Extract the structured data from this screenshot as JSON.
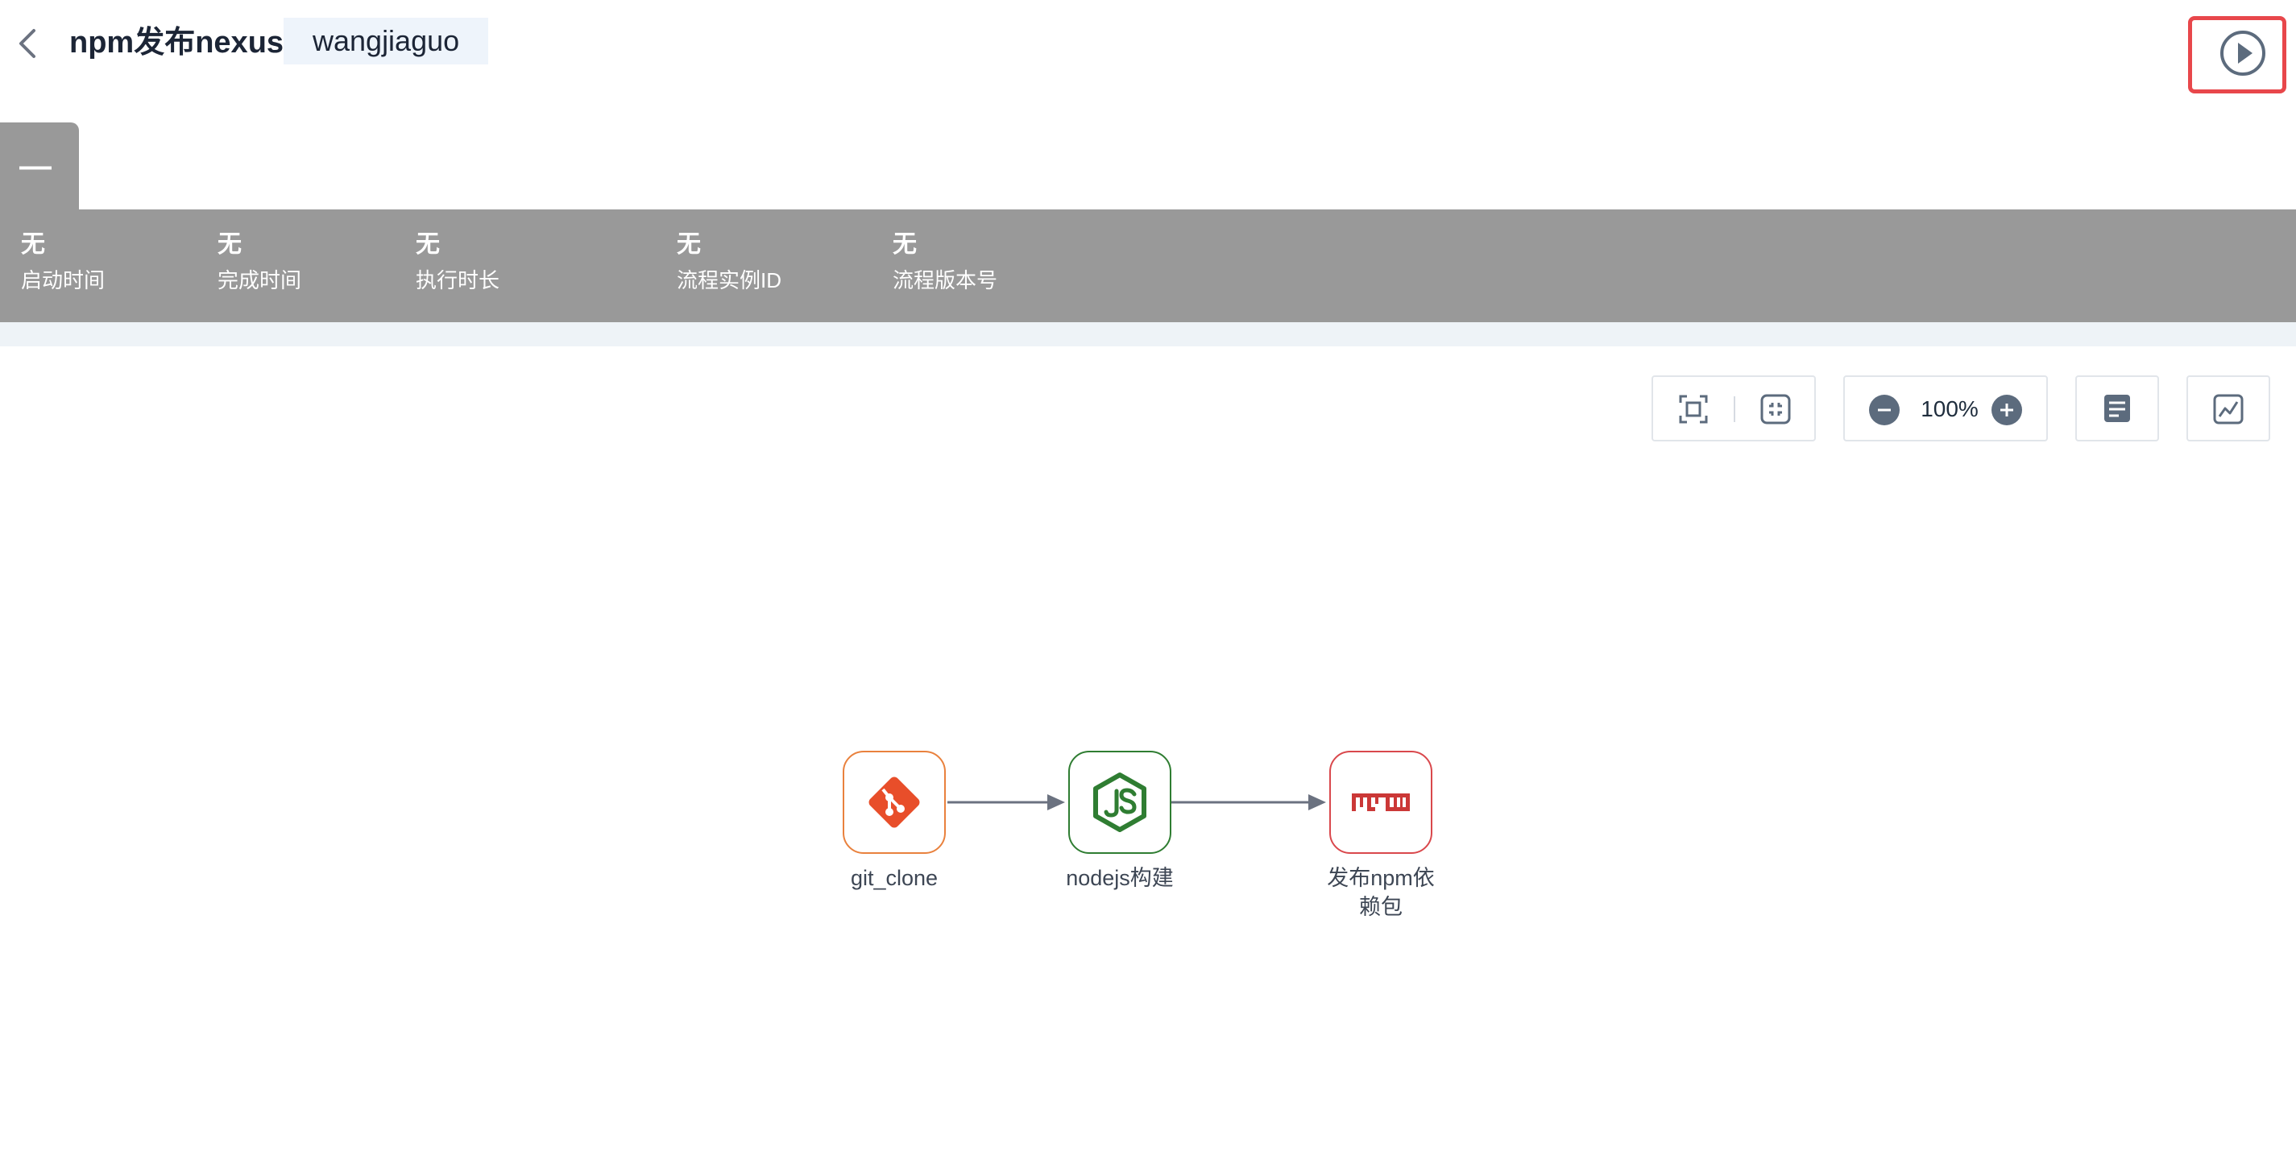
{
  "header": {
    "title": "npm发布nexus",
    "tag": "wangjiaguo"
  },
  "stage": {
    "tab_label": "—",
    "stats": [
      {
        "value": "无",
        "label": "启动时间"
      },
      {
        "value": "无",
        "label": "完成时间"
      },
      {
        "value": "无",
        "label": "执行时长"
      },
      {
        "value": "无",
        "label": "流程实例ID"
      },
      {
        "value": "无",
        "label": "流程版本号"
      }
    ]
  },
  "toolbar": {
    "zoom": "100%"
  },
  "pipeline": {
    "nodes": [
      {
        "label": "git_clone",
        "icon": "git-icon",
        "color": "#e9813d"
      },
      {
        "label": "nodejs构建",
        "icon": "nodejs-icon",
        "color": "#2f7d32"
      },
      {
        "label_line1": "发布npm依",
        "label_line2": "赖包",
        "icon": "npm-icon",
        "color": "#d9484c"
      }
    ]
  },
  "colors": {
    "accent_red": "#e8474b",
    "stage_gray": "#999999",
    "edge": "#6b7280"
  }
}
